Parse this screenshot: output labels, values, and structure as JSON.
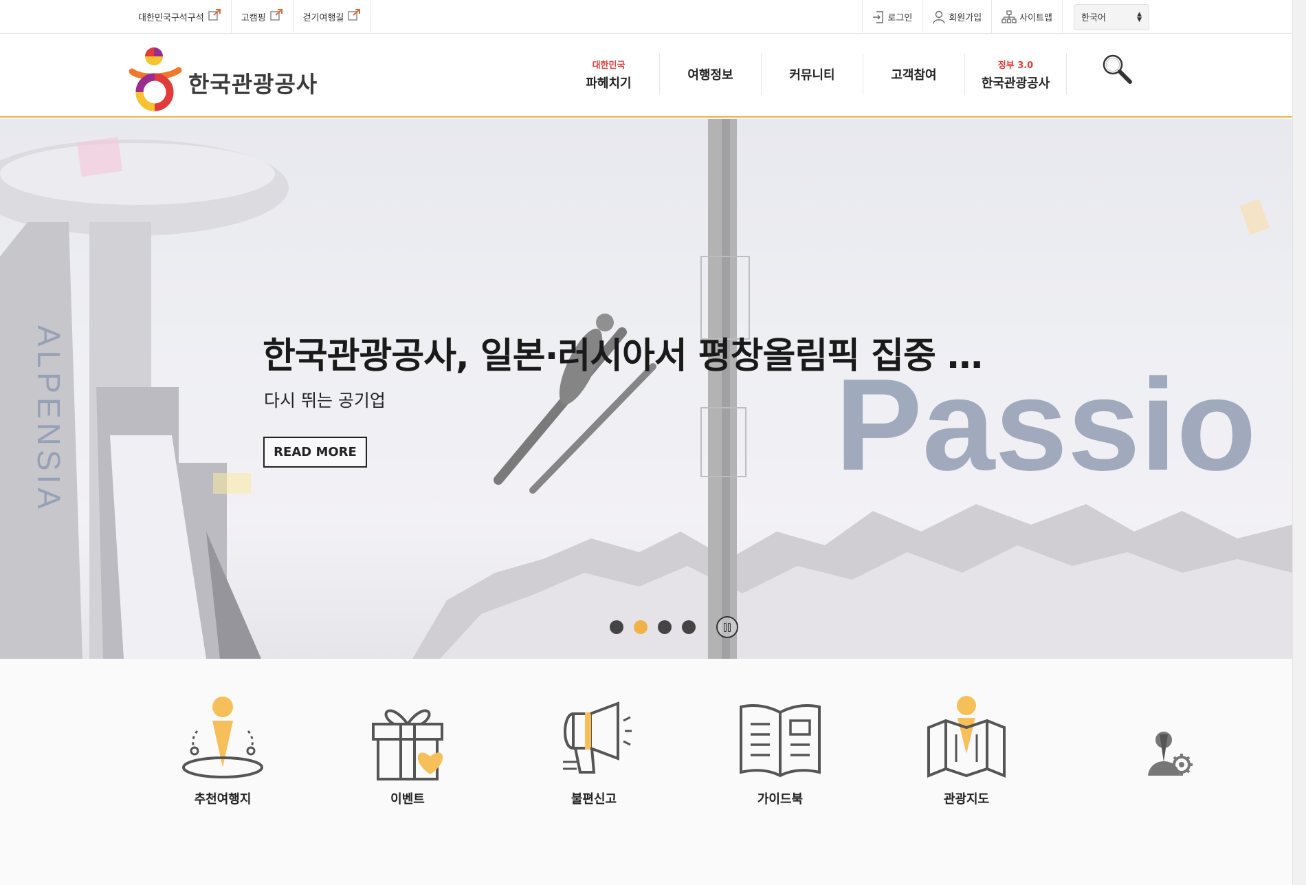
{
  "topbar": {
    "left_links": [
      {
        "label": "대한민국구석구석"
      },
      {
        "label": "고캠핑"
      },
      {
        "label": "걷기여행길"
      }
    ],
    "right_links": [
      {
        "label": "로그인",
        "icon": "login-icon"
      },
      {
        "label": "회원가입",
        "icon": "user-icon"
      },
      {
        "label": "사이트맵",
        "icon": "sitemap-icon"
      }
    ],
    "language": "한국어"
  },
  "header": {
    "logo_text": "한국관광공사",
    "nav": [
      {
        "sup": "대한민국",
        "label": "파헤치기"
      },
      {
        "sup": "",
        "label": "여행정보"
      },
      {
        "sup": "",
        "label": "커뮤니티"
      },
      {
        "sup": "",
        "label": "고객참여"
      },
      {
        "sup": "정부 3.0",
        "label": "한국관광공사"
      }
    ],
    "search_icon": "search-icon"
  },
  "hero": {
    "title": "한국관광공사, 일본·러시아서 평창올림픽 집중 …",
    "subtitle": "다시 뛰는 공기업",
    "button_label": "READ MORE",
    "background_text_tower": "ALPENSIA",
    "background_text_word": "Passio",
    "slide_count": 4,
    "active_slide": 2,
    "colors": {
      "accent": "#f0b247"
    }
  },
  "quick_menu": [
    {
      "label": "추천여행지",
      "icon": "destination-icon"
    },
    {
      "label": "이벤트",
      "icon": "gift-icon"
    },
    {
      "label": "불편신고",
      "icon": "megaphone-icon"
    },
    {
      "label": "가이드북",
      "icon": "book-icon"
    },
    {
      "label": "관광지도",
      "icon": "map-icon"
    },
    {
      "label": "",
      "icon": "admin-settings-icon"
    }
  ]
}
